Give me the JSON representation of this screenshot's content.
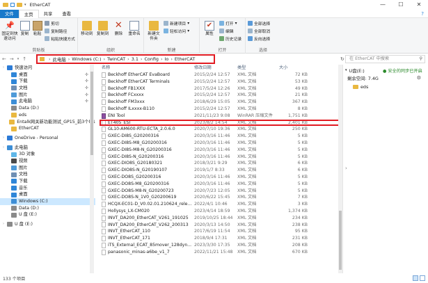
{
  "window": {
    "title": "EtherCAT"
  },
  "tabs": [
    "文件",
    "主页",
    "共享",
    "查看"
  ],
  "ribbon": {
    "clipboard": {
      "label": "剪贴板",
      "pin": "固定到快速访问",
      "copy": "复制",
      "paste": "粘贴",
      "cut": "剪切",
      "copy_path": "复制路径",
      "paste_shortcut": "粘贴快捷方式"
    },
    "organize": {
      "label": "组织",
      "move_to": "移动到",
      "copy_to": "复制到",
      "delete": "删除",
      "rename": "重命名"
    },
    "new": {
      "label": "新建",
      "new_folder": "新建文件夹",
      "new_item": "新建项目",
      "easy_access": "轻松访问"
    },
    "open": {
      "label": "打开",
      "properties": "属性",
      "open": "打开",
      "edit": "编辑",
      "history": "历史记录"
    },
    "select": {
      "label": "选择",
      "select_all": "全部选择",
      "select_none": "全部取消",
      "invert": "反向选择"
    }
  },
  "address": {
    "crumbs": [
      "此电脑",
      "Windows (C:)",
      "TwinCAT",
      "3.1",
      "Config",
      "Io",
      "EtherCAT"
    ],
    "search_placeholder": "在 EtherCAT 中搜索"
  },
  "nav": {
    "items": [
      {
        "label": "快速访问",
        "icon": "star-icon",
        "color": "#2d7cd6",
        "pin": false,
        "indent": 0
      },
      {
        "label": "桌面",
        "icon": "desktop-icon",
        "color": "#2f86d8",
        "pin": true,
        "indent": 1
      },
      {
        "label": "下载",
        "icon": "download-icon",
        "color": "#2f86d8",
        "pin": true,
        "indent": 1
      },
      {
        "label": "文档",
        "icon": "document-icon",
        "color": "#6f8fb4",
        "pin": true,
        "indent": 1
      },
      {
        "label": "图片",
        "icon": "picture-icon",
        "color": "#4f9ad8",
        "pin": true,
        "indent": 1
      },
      {
        "label": "此电脑",
        "icon": "pc-icon",
        "color": "#3d8ed6",
        "pin": true,
        "indent": 1
      },
      {
        "label": "Data (D:)",
        "icon": "drive-icon",
        "color": "#8a8a8a",
        "pin": false,
        "indent": 1
      },
      {
        "label": "eds",
        "icon": "folder-icon",
        "color": "#e9b840",
        "pin": false,
        "indent": 1
      },
      {
        "label": "Entalk网关新功能测试_GP15_前3个M1",
        "icon": "folder-icon",
        "color": "#e9b840",
        "pin": false,
        "indent": 1
      },
      {
        "label": "EtherCAT",
        "icon": "folder-icon",
        "color": "#e9b840",
        "pin": false,
        "indent": 1
      },
      {
        "label": "OneDrive - Personal",
        "icon": "cloud-icon",
        "color": "#2c7ad6",
        "pin": false,
        "indent": 0,
        "gap": true
      },
      {
        "label": "此电脑",
        "icon": "pc-icon",
        "color": "#3d8ed6",
        "pin": false,
        "indent": 0,
        "gap": true
      },
      {
        "label": "3D 对象",
        "icon": "cube-icon",
        "color": "#5fb7e8",
        "pin": false,
        "indent": 1
      },
      {
        "label": "视频",
        "icon": "video-icon",
        "color": "#4a4a4a",
        "pin": false,
        "indent": 1
      },
      {
        "label": "图片",
        "icon": "picture-icon",
        "color": "#4f9ad8",
        "pin": false,
        "indent": 1
      },
      {
        "label": "文档",
        "icon": "document-icon",
        "color": "#6f8fb4",
        "pin": false,
        "indent": 1
      },
      {
        "label": "下载",
        "icon": "download-icon",
        "color": "#2f86d8",
        "pin": false,
        "indent": 1
      },
      {
        "label": "音乐",
        "icon": "music-icon",
        "color": "#2f86d8",
        "pin": false,
        "indent": 1
      },
      {
        "label": "桌面",
        "icon": "desktop-icon",
        "color": "#2f86d8",
        "pin": false,
        "indent": 1
      },
      {
        "label": "Windows (C:)",
        "icon": "drive-icon",
        "color": "#3d8ed6",
        "pin": false,
        "indent": 1,
        "selected": true
      },
      {
        "label": "Data (D:)",
        "icon": "drive-icon",
        "color": "#8a8a8a",
        "pin": false,
        "indent": 1
      },
      {
        "label": "U 盘 (E:)",
        "icon": "usb-icon",
        "color": "#8a8a8a",
        "pin": false,
        "indent": 1
      },
      {
        "label": "U 盘 (E:)",
        "icon": "usb-icon",
        "color": "#8a8a8a",
        "pin": false,
        "indent": 0,
        "gap": true
      }
    ]
  },
  "list": {
    "headers": [
      "名称",
      "修改日期",
      "类型",
      "大小"
    ],
    "rows": [
      {
        "name": "Beckhoff EtherCAT EvaBoard",
        "date": "2015/2/24 12:57",
        "type": "XML 文档",
        "size": "72 KB",
        "kind": "xml"
      },
      {
        "name": "Beckhoff EtherCAT Terminals",
        "date": "2015/2/24 12:57",
        "type": "XML 文档",
        "size": "53 KB",
        "kind": "xml"
      },
      {
        "name": "Beckhoff FB1XXX",
        "date": "2017/5/24 12:26",
        "type": "XML 文档",
        "size": "49 KB",
        "kind": "xml"
      },
      {
        "name": "Beckhoff FCxxxx",
        "date": "2015/2/24 12:57",
        "type": "XML 文档",
        "size": "21 KB",
        "kind": "xml"
      },
      {
        "name": "Beckhoff FM3xxx",
        "date": "2018/6/29 15:05",
        "type": "XML 文档",
        "size": "367 KB",
        "kind": "xml"
      },
      {
        "name": "Beckhoff ILxxxx-B110",
        "date": "2015/2/24 12:57",
        "type": "XML 文档",
        "size": "8 KB",
        "kind": "xml"
      },
      {
        "name": "ENI Tool",
        "date": "2021/11/23 9:08",
        "type": "WinRAR 压缩文件",
        "size": "1,751 KB",
        "kind": "rar"
      },
      {
        "name": "ET405_ESI",
        "date": "2023/8/2 14:54",
        "type": "XML 文档",
        "size": "2,401 KB",
        "kind": "xml",
        "highlight": true
      },
      {
        "name": "GL10-AM600-RTU-ECTA_2.0.6.0",
        "date": "2020/7/10 19:36",
        "type": "XML 文档",
        "size": "250 KB",
        "kind": "xml"
      },
      {
        "name": "GXEC-DI8S_G20200316",
        "date": "2020/3/16 11:46",
        "type": "XML 文档",
        "size": "5 KB",
        "kind": "xml"
      },
      {
        "name": "GXEC-DI8S-M8_G20200316",
        "date": "2020/3/16 11:46",
        "type": "XML 文档",
        "size": "5 KB",
        "kind": "xml"
      },
      {
        "name": "GXEC-DI8S-M8-N_G20200316",
        "date": "2020/3/16 11:46",
        "type": "XML 文档",
        "size": "5 KB",
        "kind": "xml"
      },
      {
        "name": "GXEC-DI8S-N_G20200316",
        "date": "2020/3/16 11:46",
        "type": "XML 文档",
        "size": "5 KB",
        "kind": "xml"
      },
      {
        "name": "GXEC-DIO8S_G20180321",
        "date": "2018/3/21 9:29",
        "type": "XML 文档",
        "size": "6 KB",
        "kind": "xml"
      },
      {
        "name": "GXEC-DIO8S-N_G20190107",
        "date": "2019/1/7 8:33",
        "type": "XML 文档",
        "size": "6 KB",
        "kind": "xml"
      },
      {
        "name": "GXEC-DO8S_G20200316",
        "date": "2020/3/16 11:46",
        "type": "XML 文档",
        "size": "5 KB",
        "kind": "xml"
      },
      {
        "name": "GXEC-DO8S-M8_G20200316",
        "date": "2020/3/16 11:46",
        "type": "XML 文档",
        "size": "5 KB",
        "kind": "xml"
      },
      {
        "name": "GXEC-DO8S-M8-N_G20200723",
        "date": "2020/7/23 12:05",
        "type": "XML 文档",
        "size": "5 KB",
        "kind": "xml"
      },
      {
        "name": "GXEC-DO8S-N_1V0_G20200619",
        "date": "2020/6/22 15:45",
        "type": "XML 文档",
        "size": "7 KB",
        "kind": "xml"
      },
      {
        "name": "HCQX-EC01-D_V0.02.01.210624_rele...",
        "date": "2022/4/1 10:46",
        "type": "XML 文档",
        "size": "3 KB",
        "kind": "xml"
      },
      {
        "name": "Hollysys_LX-CM020",
        "date": "2023/4/14 18:59",
        "type": "XML 文档",
        "size": "1,374 KB",
        "kind": "xml"
      },
      {
        "name": "INVT_DA200_EtherCAT_V261_191025",
        "date": "2019/10/25 18:44",
        "type": "XML 文档",
        "size": "234 KB",
        "kind": "xml"
      },
      {
        "name": "INVT_DA200_EtherCAT_V262_200313",
        "date": "2020/3/13 14:50",
        "type": "XML 文档",
        "size": "238 KB",
        "kind": "xml"
      },
      {
        "name": "INVT_EtherCAT_110",
        "date": "2017/6/19 11:54",
        "type": "XML 文档",
        "size": "95 KB",
        "kind": "xml"
      },
      {
        "name": "INVT_EtherCAT_171",
        "date": "2018/9/4 17:31",
        "type": "XML 文档",
        "size": "231 KB",
        "kind": "xml"
      },
      {
        "name": "iTS_External_ECAT_85mover_128dyn...",
        "date": "2023/3/30 17:35",
        "type": "XML 文档",
        "size": "208 KB",
        "kind": "xml"
      },
      {
        "name": "panasonic_minas-a6be_v1_7",
        "date": "2022/11/21 15:48",
        "type": "XML 文档",
        "size": "670 KB",
        "kind": "xml"
      }
    ]
  },
  "detail": {
    "drive": "U盘(E:)",
    "sync_status": "安全的同步已开启",
    "free_space": "剩余空间: 7.4G",
    "folder": "eds"
  },
  "status": {
    "count": "133 个项目"
  }
}
